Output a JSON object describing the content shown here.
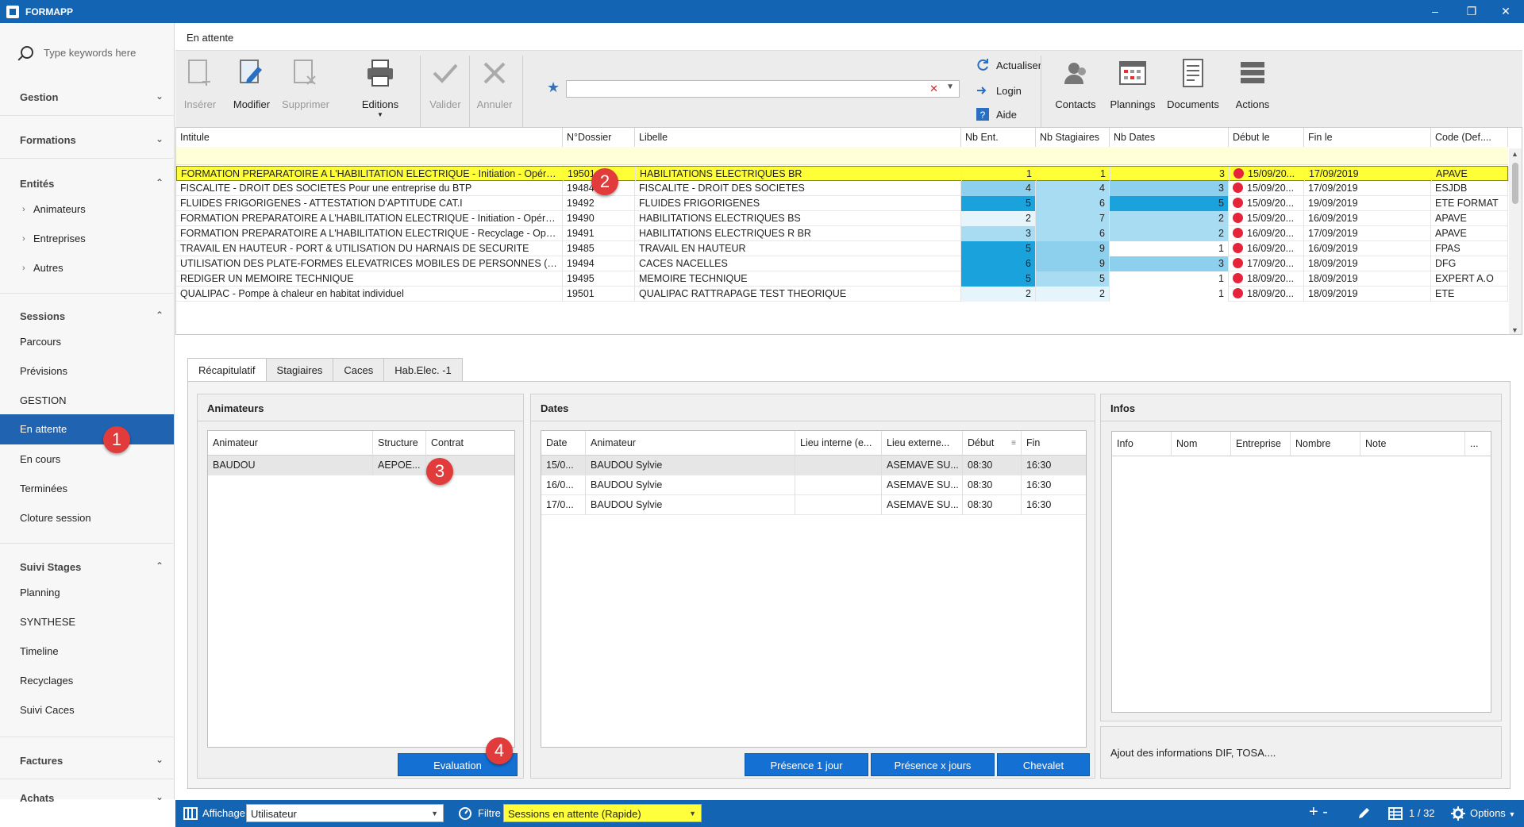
{
  "app": {
    "title": "FORMAPP"
  },
  "window_controls": {
    "minimize": "–",
    "restore": "❐",
    "close": "✕"
  },
  "sidebar": {
    "search_placeholder": "Type keywords here",
    "groups": [
      {
        "title": "Gestion",
        "expanded": false
      },
      {
        "title": "Formations",
        "expanded": false
      },
      {
        "title": "Entités",
        "expanded": true,
        "items": [
          "Animateurs",
          "Entreprises",
          "Autres"
        ]
      },
      {
        "title": "Sessions",
        "expanded": true,
        "items": [
          "Parcours",
          "Prévisions",
          "GESTION",
          "En attente",
          "En cours",
          "Terminées",
          "Cloture session"
        ],
        "active": "En attente"
      },
      {
        "title": "Suivi Stages",
        "expanded": true,
        "items": [
          "Planning",
          "SYNTHESE",
          "Timeline",
          "Recyclages",
          "Suivi Caces"
        ]
      },
      {
        "title": "Factures",
        "expanded": false
      },
      {
        "title": "Achats",
        "expanded": false
      }
    ]
  },
  "markers": [
    "1",
    "2",
    "3",
    "4"
  ],
  "page": {
    "title": "En attente"
  },
  "toolbar": {
    "insert": "Insérer",
    "edit": "Modifier",
    "delete": "Supprimer",
    "editions": "Editions",
    "validate": "Valider",
    "cancel": "Annuler",
    "search_value": "",
    "refresh": "Actualiser",
    "login": "Login",
    "help": "Aide",
    "contacts": "Contacts",
    "plannings": "Plannings",
    "documents": "Documents",
    "actions": "Actions"
  },
  "grid": {
    "columns": [
      "Intitule",
      "N°Dossier",
      "Libelle",
      "Nb Ent.",
      "Nb Stagiaires",
      "Nb Dates",
      "Début le",
      "Fin le",
      "Code (Def...."
    ],
    "rows": [
      {
        "intitule": "FORMATION PREPARATOIRE A L'HABILITATION ELECTRIQUE - Initiation - Opérati...",
        "dossier": "19501",
        "libelle": "HABILITATIONS ELECTRIQUES BR",
        "nb_ent": "1",
        "nb_stag": "1",
        "nb_dates": "3",
        "debut": "15/09/20...",
        "fin": "17/09/2019",
        "code": "APAVE",
        "selected": true
      },
      {
        "intitule": "FISCALITE - DROIT DES SOCIETES Pour une entreprise du BTP",
        "dossier": "19484",
        "libelle": "FISCALITE - DROIT DES SOCIETES",
        "nb_ent": "4",
        "nb_stag": "4",
        "nb_dates": "3",
        "debut": "15/09/20...",
        "fin": "17/09/2019",
        "code": "ESJDB"
      },
      {
        "intitule": "FLUIDES FRIGORIGENES - ATTESTATION D'APTITUDE CAT.I",
        "dossier": "19492",
        "libelle": "FLUIDES FRIGORIGENES",
        "nb_ent": "5",
        "nb_stag": "6",
        "nb_dates": "5",
        "debut": "15/09/20...",
        "fin": "19/09/2019",
        "code": "ETE FORMAT"
      },
      {
        "intitule": "FORMATION PREPARATOIRE A L'HABILITATION ELECTRIQUE - Initiation - Opérati...",
        "dossier": "19490",
        "libelle": "HABILITATIONS ELECTRIQUES BS",
        "nb_ent": "2",
        "nb_stag": "7",
        "nb_dates": "2",
        "debut": "15/09/20...",
        "fin": "16/09/2019",
        "code": "APAVE"
      },
      {
        "intitule": "FORMATION PREPARATOIRE A L'HABILITATION ELECTRIQUE - Recyclage - Opéra...",
        "dossier": "19491",
        "libelle": "HABILITATIONS ELECTRIQUES R BR",
        "nb_ent": "3",
        "nb_stag": "6",
        "nb_dates": "2",
        "debut": "16/09/20...",
        "fin": "17/09/2019",
        "code": "APAVE"
      },
      {
        "intitule": "TRAVAIL EN HAUTEUR - PORT & UTILISATION DU HARNAIS DE SECURITE",
        "dossier": "19485",
        "libelle": "TRAVAIL EN HAUTEUR",
        "nb_ent": "5",
        "nb_stag": "9",
        "nb_dates": "1",
        "debut": "16/09/20...",
        "fin": "16/09/2019",
        "code": "FPAS"
      },
      {
        "intitule": "UTILISATION DES PLATE-FORMES ELEVATRICES MOBILES DE PERSONNES (PEMP...",
        "dossier": "19494",
        "libelle": "CACES NACELLES",
        "nb_ent": "6",
        "nb_stag": "9",
        "nb_dates": "3",
        "debut": "17/09/20...",
        "fin": "18/09/2019",
        "code": "DFG"
      },
      {
        "intitule": "REDIGER UN MEMOIRE TECHNIQUE",
        "dossier": "19495",
        "libelle": "MEMOIRE TECHNIQUE",
        "nb_ent": "5",
        "nb_stag": "5",
        "nb_dates": "1",
        "debut": "18/09/20...",
        "fin": "18/09/2019",
        "code": "EXPERT A.O"
      },
      {
        "intitule": "QUALIPAC - Pompe à chaleur en habitat individuel",
        "dossier": "19501",
        "libelle": "QUALIPAC RATTRAPAGE TEST THEORIQUE",
        "nb_ent": "2",
        "nb_stag": "2",
        "nb_dates": "1",
        "debut": "18/09/20...",
        "fin": "18/09/2019",
        "code": "ETE"
      }
    ]
  },
  "detail_tabs": [
    "Récapitulatif",
    "Stagiaires",
    "Caces",
    "Hab.Elec. -1"
  ],
  "animateurs": {
    "title": "Animateurs",
    "columns": [
      "Animateur",
      "Structure",
      "Contrat"
    ],
    "rows": [
      {
        "animateur": "BAUDOU",
        "structure": "AEPOE...",
        "contrat": ""
      }
    ],
    "button": "Evaluation"
  },
  "dates": {
    "title": "Dates",
    "columns": [
      "Date",
      "Animateur",
      "Lieu interne (e...",
      "Lieu externe...",
      "Début",
      "Fin"
    ],
    "rows": [
      {
        "date": "15/0...",
        "animateur": "BAUDOU Sylvie",
        "lieu_int": "",
        "lieu_ext": "ASEMAVE SU...",
        "debut": "08:30",
        "fin": "16:30"
      },
      {
        "date": "16/0...",
        "animateur": "BAUDOU Sylvie",
        "lieu_int": "",
        "lieu_ext": "ASEMAVE SU...",
        "debut": "08:30",
        "fin": "16:30"
      },
      {
        "date": "17/0...",
        "animateur": "BAUDOU Sylvie",
        "lieu_int": "",
        "lieu_ext": "ASEMAVE SU...",
        "debut": "08:30",
        "fin": "16:30"
      }
    ],
    "buttons": [
      "Présence 1 jour",
      "Présence x jours",
      "Chevalet"
    ]
  },
  "infos": {
    "title": "Infos",
    "columns": [
      "Info",
      "Nom",
      "Entreprise",
      "Nombre",
      "Note",
      "..."
    ],
    "footer_text": "Ajout des informations DIF, TOSA...."
  },
  "statusbar": {
    "affichage_label": "Affichage",
    "affichage_value": "Utilisateur",
    "filtre_label": "Filtre",
    "filtre_value": "Sessions en attente (Rapide)",
    "plus_minus": "+ -",
    "page_count": "1 / 32",
    "options": "Options"
  },
  "colors": {
    "titlebar": "#1464b4",
    "active_nav": "#1f63b1",
    "selected_row": "#ffff38",
    "marker": "#e23b3b",
    "button_blue": "#1470d3",
    "status_dot": "#e5243b",
    "heat_low": "#e6f4fb",
    "heat_mid": "#a8dcf2",
    "heat_high": "#8dd0ee",
    "heat_max": "#1aa2dd"
  }
}
